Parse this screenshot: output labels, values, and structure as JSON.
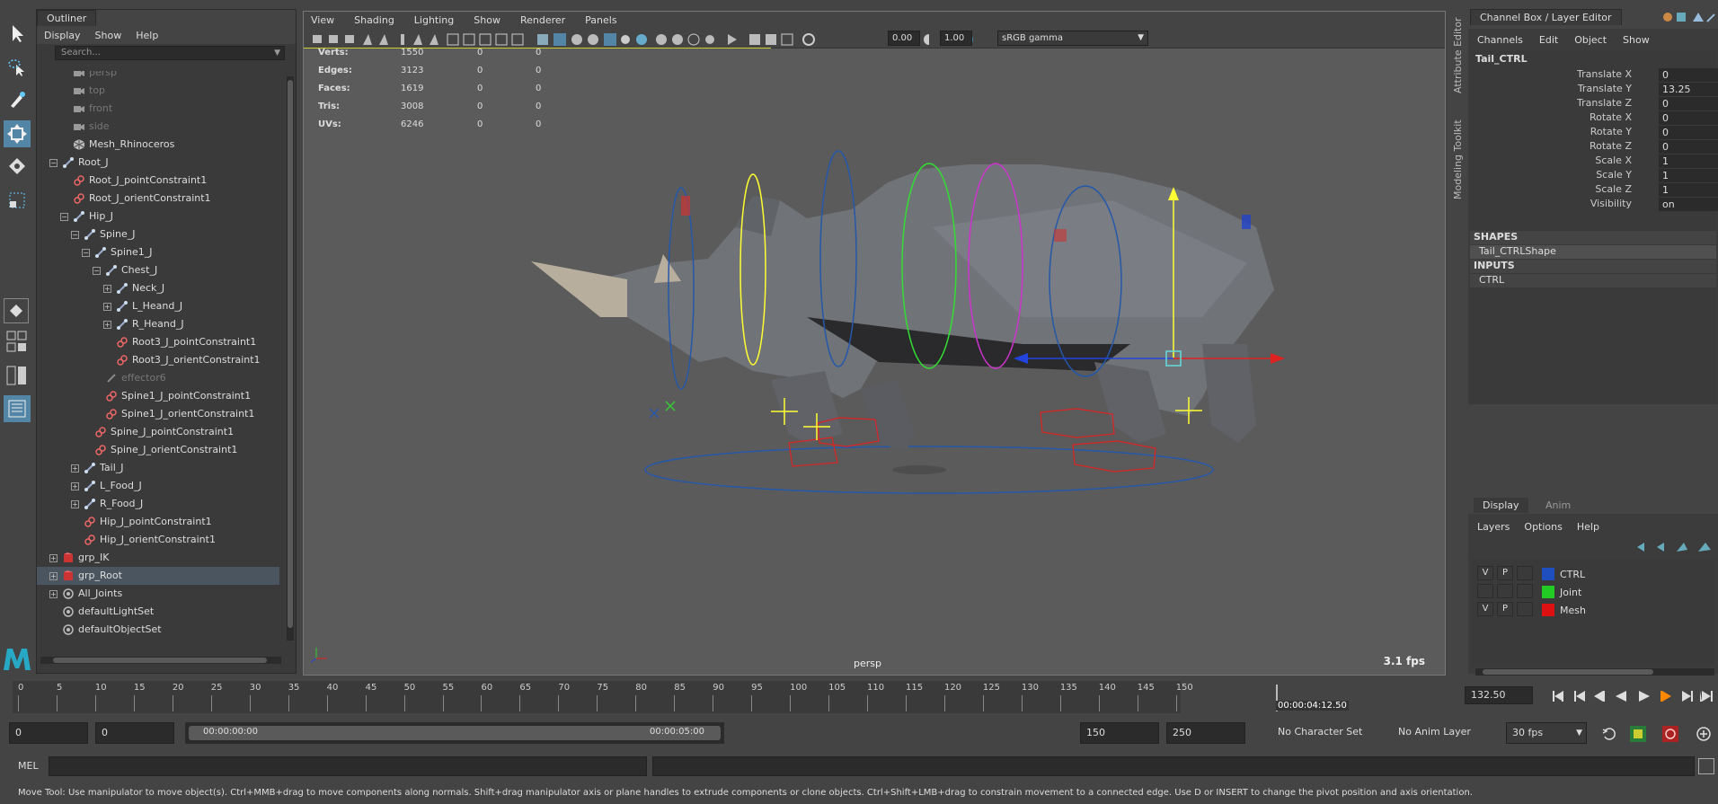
{
  "outliner": {
    "tab": "Outliner",
    "menu": [
      "Display",
      "Show",
      "Help"
    ],
    "search_placeholder": "Search...",
    "items": [
      {
        "label": "persp",
        "dim": true
      },
      {
        "label": "top",
        "dim": true
      },
      {
        "label": "front",
        "dim": true
      },
      {
        "label": "side",
        "dim": true
      },
      {
        "label": "Mesh_Rhinoceros"
      },
      {
        "label": "Root_J"
      },
      {
        "label": "Root_J_pointConstraint1"
      },
      {
        "label": "Root_J_orientConstraint1"
      },
      {
        "label": "Hip_J"
      },
      {
        "label": "Spine_J"
      },
      {
        "label": "Spine1_J"
      },
      {
        "label": "Chest_J"
      },
      {
        "label": "Neck_J"
      },
      {
        "label": "L_Heand_J"
      },
      {
        "label": "R_Heand_J"
      },
      {
        "label": "Root3_J_pointConstraint1"
      },
      {
        "label": "Root3_J_orientConstraint1"
      },
      {
        "label": "effector6",
        "dim": true
      },
      {
        "label": "Spine1_J_pointConstraint1"
      },
      {
        "label": "Spine1_J_orientConstraint1"
      },
      {
        "label": "Spine_J_pointConstraint1"
      },
      {
        "label": "Spine_J_orientConstraint1"
      },
      {
        "label": "Tail_J"
      },
      {
        "label": "L_Food_J"
      },
      {
        "label": "R_Food_J"
      },
      {
        "label": "Hip_J_pointConstraint1"
      },
      {
        "label": "Hip_J_orientConstraint1"
      },
      {
        "label": "grp_IK"
      },
      {
        "label": "grp_Root",
        "selected": true
      },
      {
        "label": "All_Joints"
      },
      {
        "label": "defaultLightSet"
      },
      {
        "label": "defaultObjectSet"
      }
    ]
  },
  "viewport": {
    "menu": [
      "View",
      "Shading",
      "Lighting",
      "Show",
      "Renderer",
      "Panels"
    ],
    "exposure": "0.00",
    "gamma": "1.00",
    "color_space": "sRGB gamma",
    "camera_label": "persp",
    "fps": "3.1 fps",
    "hud": [
      {
        "label": "Verts:",
        "a": "1550",
        "b": "0",
        "c": "0"
      },
      {
        "label": "Edges:",
        "a": "3123",
        "b": "0",
        "c": "0"
      },
      {
        "label": "Faces:",
        "a": "1619",
        "b": "0",
        "c": "0"
      },
      {
        "label": "Tris:",
        "a": "3008",
        "b": "0",
        "c": "0"
      },
      {
        "label": "UVs:",
        "a": "6246",
        "b": "0",
        "c": "0"
      }
    ]
  },
  "side_tabs": [
    "Attribute Editor",
    "Modeling Toolkit"
  ],
  "channel_box": {
    "title": "Channel Box / Layer Editor",
    "menu": [
      "Channels",
      "Edit",
      "Object",
      "Show"
    ],
    "object": "Tail_CTRL",
    "attrs": [
      {
        "name": "Translate X",
        "value": "0"
      },
      {
        "name": "Translate Y",
        "value": "13.25"
      },
      {
        "name": "Translate Z",
        "value": "0"
      },
      {
        "name": "Rotate X",
        "value": "0"
      },
      {
        "name": "Rotate Y",
        "value": "0"
      },
      {
        "name": "Rotate Z",
        "value": "0"
      },
      {
        "name": "Scale X",
        "value": "1"
      },
      {
        "name": "Scale Y",
        "value": "1"
      },
      {
        "name": "Scale Z",
        "value": "1"
      },
      {
        "name": "Visibility",
        "value": "on"
      }
    ],
    "shapes_header": "SHAPES",
    "shape": "Tail_CTRLShape",
    "inputs_header": "INPUTS",
    "input": "CTRL"
  },
  "layer_editor": {
    "tabs": [
      "Display",
      "Anim"
    ],
    "menu": [
      "Layers",
      "Options",
      "Help"
    ],
    "layers": [
      {
        "v": "V",
        "p": "P",
        "name": "CTRL",
        "color": "#1f4fbf"
      },
      {
        "v": "",
        "p": "",
        "name": "Joint",
        "color": "#22cc22"
      },
      {
        "v": "V",
        "p": "P",
        "name": "Mesh",
        "color": "#dd1111"
      }
    ]
  },
  "timeline": {
    "ticks": [
      "0",
      "5",
      "10",
      "15",
      "20",
      "25",
      "30",
      "35",
      "40",
      "45",
      "50",
      "55",
      "60",
      "65",
      "70",
      "75",
      "80",
      "85",
      "90",
      "95",
      "100",
      "105",
      "110",
      "115",
      "120",
      "125",
      "130",
      "135",
      "140",
      "145",
      "150"
    ],
    "current_time": "00:00:04:12.50",
    "current_frame": "132.50"
  },
  "range": {
    "start": "0",
    "playback_start": "0",
    "range_start_time": "00:00:00:00",
    "range_end_time": "00:00:05:00",
    "playback_end": "150",
    "end": "250",
    "character_set": "No Character Set",
    "anim_layer": "No Anim Layer",
    "fps": "30 fps"
  },
  "mel_label": "MEL",
  "status_text": "Move Tool: Use manipulator to move object(s). Ctrl+MMB+drag to move components along normals. Shift+drag manipulator axis or plane handles to extrude components or clone objects. Ctrl+Shift+LMB+drag to constrain movement to a connected edge. Use D or INSERT to change the pivot position and axis orientation."
}
